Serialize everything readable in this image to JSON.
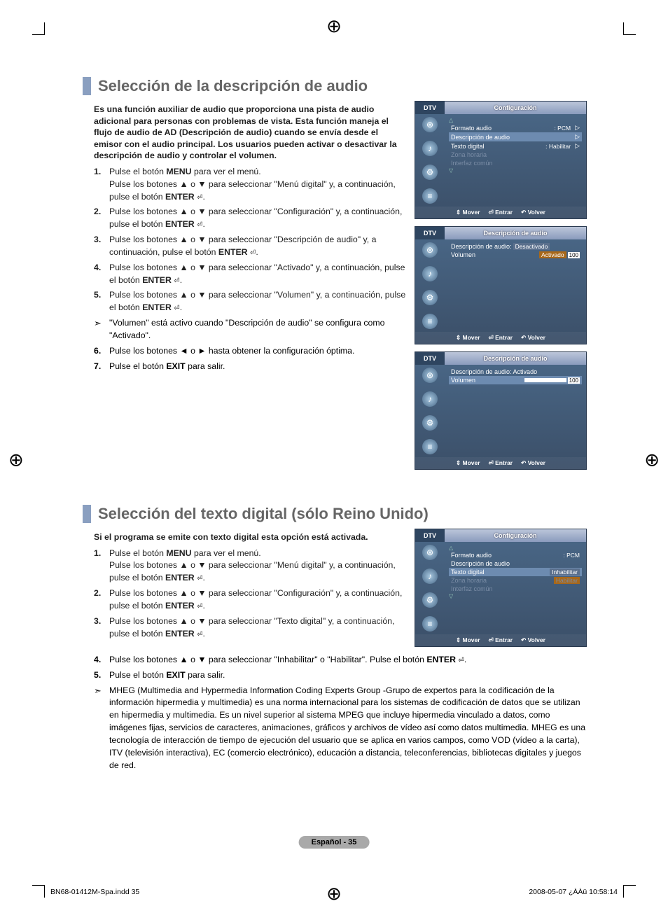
{
  "section1": {
    "title": "Selección de la descripción de audio",
    "intro": "Es una función auxiliar de audio que proporciona una pista de audio adicional para personas con problemas de vista.  Esta función maneja el flujo de audio de AD (Descripción de audio) cuando se envía desde el emisor con el audio principal. Los usuarios pueden activar o desactivar la descripción de audio y controlar el volumen.",
    "steps": [
      "Pulse el botón <b>MENU</b> para ver el menú.<br>Pulse los botones ▲ o ▼ para seleccionar \"Menú digital\" y, a continuación, pulse el botón <b>ENTER</b> <span class='enter-icon'></span>.",
      "Pulse los botones ▲ o ▼ para seleccionar \"Configuración\" y, a continuación, pulse el botón <b>ENTER</b> <span class='enter-icon'></span>.",
      "Pulse los botones ▲ o ▼ para seleccionar \"Descripción de audio\" y, a continuación, pulse el botón <b>ENTER</b> <span class='enter-icon'></span>.",
      "Pulse los botones ▲ o ▼ para seleccionar \"Activado\" y, a continuación, pulse el botón <b>ENTER</b> <span class='enter-icon'></span>.",
      "Pulse los botones ▲ o ▼ para seleccionar \"Volumen\" y, a continuación, pulse el botón <b>ENTER</b> <span class='enter-icon'></span>."
    ],
    "note": "\"Volumen\" está activo cuando \"Descripción de audio\" se configura como \"Activado\".",
    "steps2": [
      {
        "n": "6.",
        "t": "Pulse los botones ◄ o ► hasta obtener la configuración óptima."
      },
      {
        "n": "7.",
        "t": "Pulse el botón <b>EXIT</b> para salir."
      }
    ]
  },
  "section2": {
    "title": "Selección del texto digital (sólo Reino Unido)",
    "intro": "Si el programa se emite con texto digital esta opción está activada.",
    "steps": [
      "Pulse el botón <b>MENU</b> para ver el menú.<br>Pulse los botones ▲ o ▼ para seleccionar \"Menú digital\" y, a continuación, pulse el botón <b>ENTER</b> <span class='enter-icon'></span>.",
      "Pulse los botones ▲ o ▼ para seleccionar \"Configuración\" y, a continuación, pulse el botón <b>ENTER</b> <span class='enter-icon'></span>.",
      "Pulse los botones ▲ o ▼ para seleccionar \"Texto digital\" y, a continuación, pulse el botón <b>ENTER</b> <span class='enter-icon'></span>."
    ],
    "steps2": [
      {
        "n": "4.",
        "t": "Pulse los botones ▲ o ▼ para seleccionar \"Inhabilitar\" o \"Habilitar\". Pulse el botón <b>ENTER</b> <span class='enter-icon'></span>."
      },
      {
        "n": "5.",
        "t": "Pulse el botón <b>EXIT</b> para salir."
      }
    ],
    "note": "MHEG (Multimedia and Hypermedia Information Coding Experts Group -Grupo de expertos para la codificación de la información hipermedia y multimedia) es una norma internacional para los sistemas de codificación de datos que se utilizan en hipermedia y multimedia. Es un nivel superior al sistema MPEG que incluye hipermedia vinculado a datos, como imágenes fijas, servicios de caracteres, animaciones, gráficos y archivos de vídeo así como datos multimedia. MHEG es una tecnología de interacción de tiempo de ejecución del usuario que se aplica en varios campos, como VOD (vídeo a la carta), ITV (televisión interactiva), EC (comercio electrónico), educación a distancia, teleconferencias, bibliotecas digitales y juegos de red."
  },
  "tv1": {
    "dtv": "DTV",
    "title": "Configuración",
    "rows": {
      "formato": "Formato audio",
      "formato_v": ": PCM",
      "desc": "Descripción de audio",
      "texto": "Texto digital",
      "texto_v": ": Habilitar",
      "zona": "Zona horaria",
      "interfaz": "Interfaz común"
    }
  },
  "tv2": {
    "dtv": "DTV",
    "title": "Descripción de audio",
    "desc": "Descripción de audio:",
    "off": "Desactivado",
    "on": "Activado",
    "vol": "Volumen",
    "vol_v": "100"
  },
  "tv3": {
    "dtv": "DTV",
    "title": "Descripción de audio",
    "desc": "Descripción de audio: Activado",
    "vol": "Volumen",
    "vol_v": "100"
  },
  "tv4": {
    "dtv": "DTV",
    "title": "Configuración",
    "rows": {
      "formato": "Formato audio",
      "formato_v": ": PCM",
      "desc": "Descripción de audio",
      "texto": "Texto digital",
      "inhab": "Inhabilitar",
      "hab": "Habilitar",
      "zona": "Zona horaria",
      "interfaz": "Interfaz común"
    }
  },
  "tvfoot": {
    "mover": "Mover",
    "entrar": "Entrar",
    "volver": "Volver"
  },
  "page_footer": "Español - 35",
  "print_left": "BN68-01412M-Spa.indd   35",
  "print_right": "2008-05-07   ¿ÀÀü 10:58:14"
}
